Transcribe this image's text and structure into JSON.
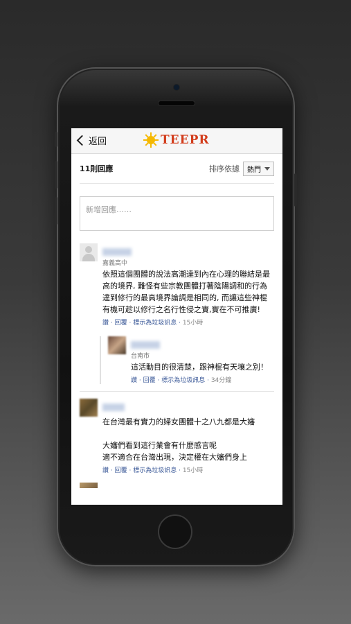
{
  "header": {
    "back_label": "返回",
    "logo_text": "TEEPR"
  },
  "comments_header": {
    "count": "11則回應",
    "sort_label": "排序依據",
    "sort_value": "熱門"
  },
  "new_comment": {
    "placeholder": "新增回應……"
  },
  "comments": [
    {
      "author": "■■■■",
      "location": "嘉義高中",
      "text": "依照這個團體的說法高潮達到內在心理的聯結是最高的境界, 難怪有些宗教團體打著陰陽調和的行為達到修行的最高境界論調是相同的, 而讓這些神棍有機可趁以修行之名行性侵之實,實在不可推廣!",
      "actions": {
        "like": "讚",
        "reply": "回覆",
        "spam": "標示為垃圾訊息",
        "time": "15小時"
      },
      "reply": {
        "author": "■■■■",
        "location": "台南市",
        "text": "這活動目的很清楚，跟神棍有天壤之別！",
        "actions": {
          "like": "讚",
          "reply": "回覆",
          "spam": "標示為垃圾訊息",
          "time": "34分鐘"
        }
      }
    },
    {
      "author": "■■■",
      "text": "在台灣最有實力的婦女團體十之八九都是大嬸\n\n大嬸們看到這行業會有什麼感言呢\n適不適合在台灣出現，決定權在大嬸們身上",
      "actions": {
        "like": "讚",
        "reply": "回覆",
        "spam": "標示為垃圾訊息",
        "time": "15小時"
      }
    }
  ],
  "separator": " · "
}
